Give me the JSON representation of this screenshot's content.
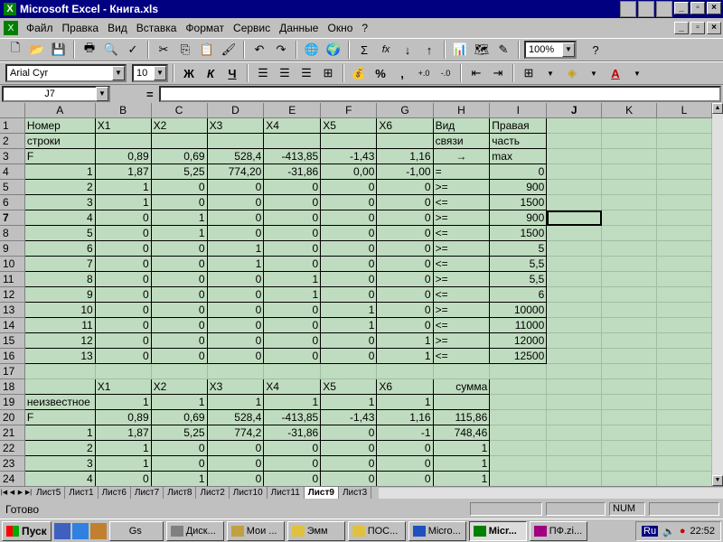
{
  "window": {
    "title": "Microsoft Excel - Книга.xls",
    "app_icon": "excel-icon"
  },
  "menu": [
    "Файл",
    "Правка",
    "Вид",
    "Вставка",
    "Формат",
    "Сервис",
    "Данные",
    "Окно",
    "?"
  ],
  "toolbar": {
    "zoom": "100%",
    "font": "Arial Cyr",
    "font_size": "10",
    "bold": "Ж",
    "italic": "К",
    "underline": "Ч",
    "sigma": "Σ",
    "fx": "fx",
    "percent": "%",
    "comma": ","
  },
  "formula": {
    "cell_ref": "J7",
    "eq": "=",
    "value": ""
  },
  "columns": [
    "A",
    "B",
    "C",
    "D",
    "E",
    "F",
    "G",
    "H",
    "I",
    "J",
    "K",
    "L"
  ],
  "rows": [
    [
      "Номер",
      "X1",
      "X2",
      "X3",
      "X4",
      "X5",
      "X6",
      "Вид",
      "Правая",
      "",
      "",
      ""
    ],
    [
      "строки",
      "",
      "",
      "",
      "",
      "",
      "",
      "связи",
      "часть",
      "",
      "",
      ""
    ],
    [
      "F",
      "0,89",
      "0,69",
      "528,4",
      "-413,85",
      "-1,43",
      "1,16",
      "→",
      "max",
      "",
      "",
      ""
    ],
    [
      "1",
      "1,87",
      "5,25",
      "774,20",
      "-31,86",
      "0,00",
      "-1,00",
      "=",
      "0",
      "",
      "",
      ""
    ],
    [
      "2",
      "1",
      "0",
      "0",
      "0",
      "0",
      "0",
      ">=",
      "900",
      "",
      "",
      ""
    ],
    [
      "3",
      "1",
      "0",
      "0",
      "0",
      "0",
      "0",
      "<=",
      "1500",
      "",
      "",
      ""
    ],
    [
      "4",
      "0",
      "1",
      "0",
      "0",
      "0",
      "0",
      ">=",
      "900",
      "",
      "",
      ""
    ],
    [
      "5",
      "0",
      "1",
      "0",
      "0",
      "0",
      "0",
      "<=",
      "1500",
      "",
      "",
      ""
    ],
    [
      "6",
      "0",
      "0",
      "1",
      "0",
      "0",
      "0",
      ">=",
      "5",
      "",
      "",
      ""
    ],
    [
      "7",
      "0",
      "0",
      "1",
      "0",
      "0",
      "0",
      "<=",
      "5,5",
      "",
      "",
      ""
    ],
    [
      "8",
      "0",
      "0",
      "0",
      "1",
      "0",
      "0",
      ">=",
      "5,5",
      "",
      "",
      ""
    ],
    [
      "9",
      "0",
      "0",
      "0",
      "1",
      "0",
      "0",
      "<=",
      "6",
      "",
      "",
      ""
    ],
    [
      "10",
      "0",
      "0",
      "0",
      "0",
      "1",
      "0",
      ">=",
      "10000",
      "",
      "",
      ""
    ],
    [
      "11",
      "0",
      "0",
      "0",
      "0",
      "1",
      "0",
      "<=",
      "11000",
      "",
      "",
      ""
    ],
    [
      "12",
      "0",
      "0",
      "0",
      "0",
      "0",
      "1",
      ">=",
      "12000",
      "",
      "",
      ""
    ],
    [
      "13",
      "0",
      "0",
      "0",
      "0",
      "0",
      "1",
      "<=",
      "12500",
      "",
      "",
      ""
    ],
    [
      "",
      "",
      "",
      "",
      "",
      "",
      "",
      "",
      "",
      "",
      "",
      ""
    ],
    [
      "",
      "X1",
      "X2",
      "X3",
      "X4",
      "X5",
      "X6",
      "сумма",
      "",
      "",
      "",
      ""
    ],
    [
      "неизвестное",
      "1",
      "1",
      "1",
      "1",
      "1",
      "1",
      "",
      "",
      "",
      "",
      ""
    ],
    [
      "F",
      "0,89",
      "0,69",
      "528,4",
      "-413,85",
      "-1,43",
      "1,16",
      "115,86",
      "",
      "",
      "",
      ""
    ],
    [
      "1",
      "1,87",
      "5,25",
      "774,2",
      "-31,86",
      "0",
      "-1",
      "748,46",
      "",
      "",
      "",
      ""
    ],
    [
      "2",
      "1",
      "0",
      "0",
      "0",
      "0",
      "0",
      "1",
      "",
      "",
      "",
      ""
    ],
    [
      "3",
      "1",
      "0",
      "0",
      "0",
      "0",
      "0",
      "1",
      "",
      "",
      "",
      ""
    ],
    [
      "4",
      "0",
      "1",
      "0",
      "0",
      "0",
      "0",
      "1",
      "",
      "",
      "",
      ""
    ]
  ],
  "sheet_tabs": [
    "Лист5",
    "Лист1",
    "Лист6",
    "Лист7",
    "Лист8",
    "Лист2",
    "Лист10",
    "Лист11",
    "Лист9",
    "Лист3"
  ],
  "active_tab": "Лист9",
  "status": {
    "left": "Готово",
    "num": "NUM"
  },
  "taskbar": {
    "start": "Пуск",
    "tasks": [
      "Gs",
      "Диск...",
      "Мои ...",
      "Эмм",
      "ПОС...",
      "Micro...",
      "Micr...",
      "ПФ.zi..."
    ],
    "active_task": "Micr...",
    "lang": "Ru",
    "clock": "22:52"
  }
}
